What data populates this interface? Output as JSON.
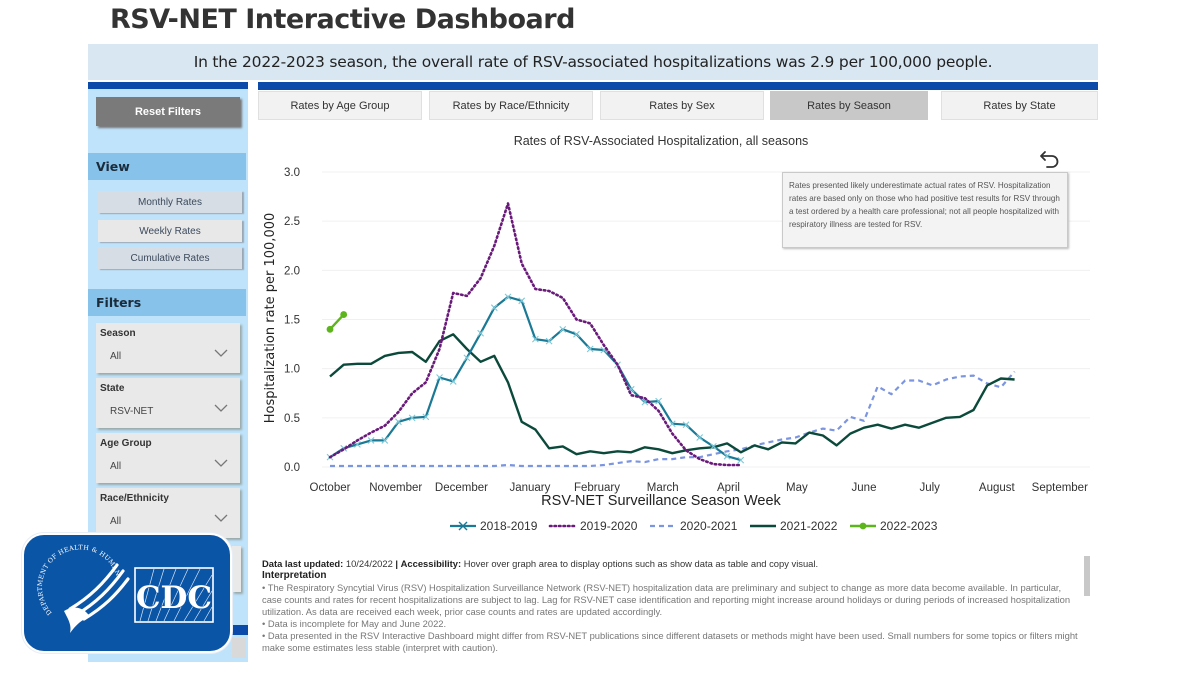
{
  "page": {
    "title": "RSV-NET Interactive Dashboard",
    "banner": "In the 2022-2023 season, the overall rate of RSV-associated hospitalizations was 2.9 per 100,000 people."
  },
  "sidebar": {
    "reset_label": "Reset Filters",
    "view_header": "View",
    "view_buttons": [
      {
        "label": "Monthly Rates"
      },
      {
        "label": "Weekly Rates",
        "active": true
      },
      {
        "label": "Cumulative Rates"
      }
    ],
    "filters_header": "Filters",
    "filters": [
      {
        "label": "Season",
        "value": "All"
      },
      {
        "label": "State",
        "value": "RSV-NET"
      },
      {
        "label": "Age Group",
        "value": "All"
      },
      {
        "label": "Race/Ethnicity",
        "value": "All"
      }
    ]
  },
  "tabs": [
    {
      "label": "Rates by Age Group"
    },
    {
      "label": "Rates by Race/Ethnicity"
    },
    {
      "label": "Rates by Sex"
    },
    {
      "label": "Rates by Season",
      "active": true
    },
    {
      "label": "Rates by State"
    }
  ],
  "icons": {
    "undo": "undo-arrow-icon",
    "chevron": "chevron-down-icon",
    "logo_hhs": "hhs-eagle-logo",
    "logo_cdc": "cdc-logo"
  },
  "colors": {
    "brand_blue": "#0b4aa8",
    "s2018": "#1a7a95",
    "s2019": "#6a1a7a",
    "s2020": "#7b95e0",
    "s2021": "#0b4a3a",
    "s2022": "#5db51c"
  },
  "tooltip": "Rates presented likely underestimate actual rates of RSV. Hospitalization rates are based only on those who had positive test results for RSV through a test ordered by a health care professional; not all people hospitalized with respiratory illness are tested for RSV.",
  "logo": {
    "hhs_text": "DEPARTMENT OF HEALTH & HUMAN SERVICES·USA",
    "cdc_text": "CDC"
  },
  "notes": {
    "updated_label": "Data last updated:",
    "updated_value": "10/24/2022",
    "sep": "|",
    "accessibility_label": "Accessibility:",
    "accessibility_text": "Hover over graph area to display options such as show data as table and copy visual.",
    "interp_header": "Interpretation",
    "bullets": [
      "The Respiratory Syncytial Virus (RSV) Hospitalization Surveillance Network (RSV-NET) hospitalization data are preliminary and subject to change as more data become available. In particular, case counts and rates for recent hospitalizations are subject to lag. Lag for RSV-NET case identification and reporting might increase around holidays or during periods of increased hospitalization utilization. As data are received each week, prior case counts and rates are updated accordingly.",
      "Data is incomplete for May and June 2022.",
      "Data presented in the RSV Interactive Dashboard might differ from RSV-NET publications since different datasets or methods might have been used. Small numbers for some topics or filters might make some estimates less stable (interpret with caution)."
    ]
  },
  "chart_data": {
    "type": "line",
    "title": "Rates of RSV-Associated Hospitalization, all seasons",
    "xlabel": "RSV-NET Surveillance Season Week",
    "ylabel": "Hospitalization rate per 100,000",
    "ylim": [
      0,
      3.0
    ],
    "yticks": [
      "0.0",
      "0.5",
      "1.0",
      "1.5",
      "2.0",
      "2.5",
      "3.0"
    ],
    "x_week_count": 53,
    "x_ticks": [
      {
        "label": "October",
        "week": 0
      },
      {
        "label": "November",
        "week": 4.8
      },
      {
        "label": "December",
        "week": 9.6
      },
      {
        "label": "January",
        "week": 14.6
      },
      {
        "label": "February",
        "week": 19.5
      },
      {
        "label": "March",
        "week": 24.3
      },
      {
        "label": "April",
        "week": 29.1
      },
      {
        "label": "May",
        "week": 34.1
      },
      {
        "label": "June",
        "week": 39.0
      },
      {
        "label": "July",
        "week": 43.8
      },
      {
        "label": "August",
        "week": 48.7
      },
      {
        "label": "September",
        "week": 53.3
      }
    ],
    "grid": true,
    "legend_position": "bottom",
    "series": [
      {
        "name": "2018-2019",
        "style": "solid-x",
        "values": [
          0.1,
          0.19,
          0.23,
          0.27,
          0.27,
          0.46,
          0.5,
          0.51,
          0.91,
          0.87,
          1.11,
          1.36,
          1.62,
          1.73,
          1.69,
          1.3,
          1.28,
          1.4,
          1.35,
          1.2,
          1.19,
          1.04,
          0.79,
          0.66,
          0.67,
          0.44,
          0.43,
          0.3,
          0.21,
          0.11,
          0.07
        ]
      },
      {
        "name": "2019-2020",
        "style": "dotted",
        "values": [
          0.1,
          0.18,
          0.27,
          0.35,
          0.42,
          0.56,
          0.75,
          0.86,
          1.2,
          1.77,
          1.74,
          1.92,
          2.25,
          2.68,
          2.07,
          1.81,
          1.79,
          1.72,
          1.5,
          1.46,
          1.24,
          1.04,
          0.73,
          0.7,
          0.57,
          0.34,
          0.17,
          0.08,
          0.03,
          0.02,
          0.02
        ]
      },
      {
        "name": "2020-2021",
        "style": "dashed",
        "values": [
          0.01,
          0.01,
          0.01,
          0.01,
          0.01,
          0.01,
          0.01,
          0.01,
          0.01,
          0.01,
          0.01,
          0.01,
          0.01,
          0.02,
          0.01,
          0.01,
          0.01,
          0.01,
          0.01,
          0.01,
          0.02,
          0.04,
          0.06,
          0.05,
          0.08,
          0.08,
          0.1,
          0.1,
          0.13,
          0.16,
          0.18,
          0.22,
          0.25,
          0.28,
          0.3,
          0.35,
          0.39,
          0.37,
          0.51,
          0.47,
          0.82,
          0.74,
          0.88,
          0.88,
          0.83,
          0.89,
          0.92,
          0.93,
          0.85,
          0.81,
          0.97
        ]
      },
      {
        "name": "2021-2022",
        "style": "solid",
        "values": [
          0.92,
          1.04,
          1.05,
          1.05,
          1.13,
          1.16,
          1.17,
          1.07,
          1.28,
          1.35,
          1.2,
          1.07,
          1.13,
          0.86,
          0.46,
          0.38,
          0.19,
          0.21,
          0.13,
          0.16,
          0.14,
          0.16,
          0.15,
          0.2,
          0.18,
          0.14,
          0.17,
          0.19,
          0.2,
          0.24,
          0.15,
          0.22,
          0.18,
          0.25,
          0.24,
          0.35,
          0.32,
          0.22,
          0.34,
          0.4,
          0.43,
          0.39,
          0.43,
          0.4,
          0.45,
          0.5,
          0.51,
          0.58,
          0.83,
          0.9,
          0.89
        ]
      },
      {
        "name": "2022-2023",
        "style": "solid-dot",
        "values": [
          1.4,
          1.55
        ]
      }
    ]
  }
}
